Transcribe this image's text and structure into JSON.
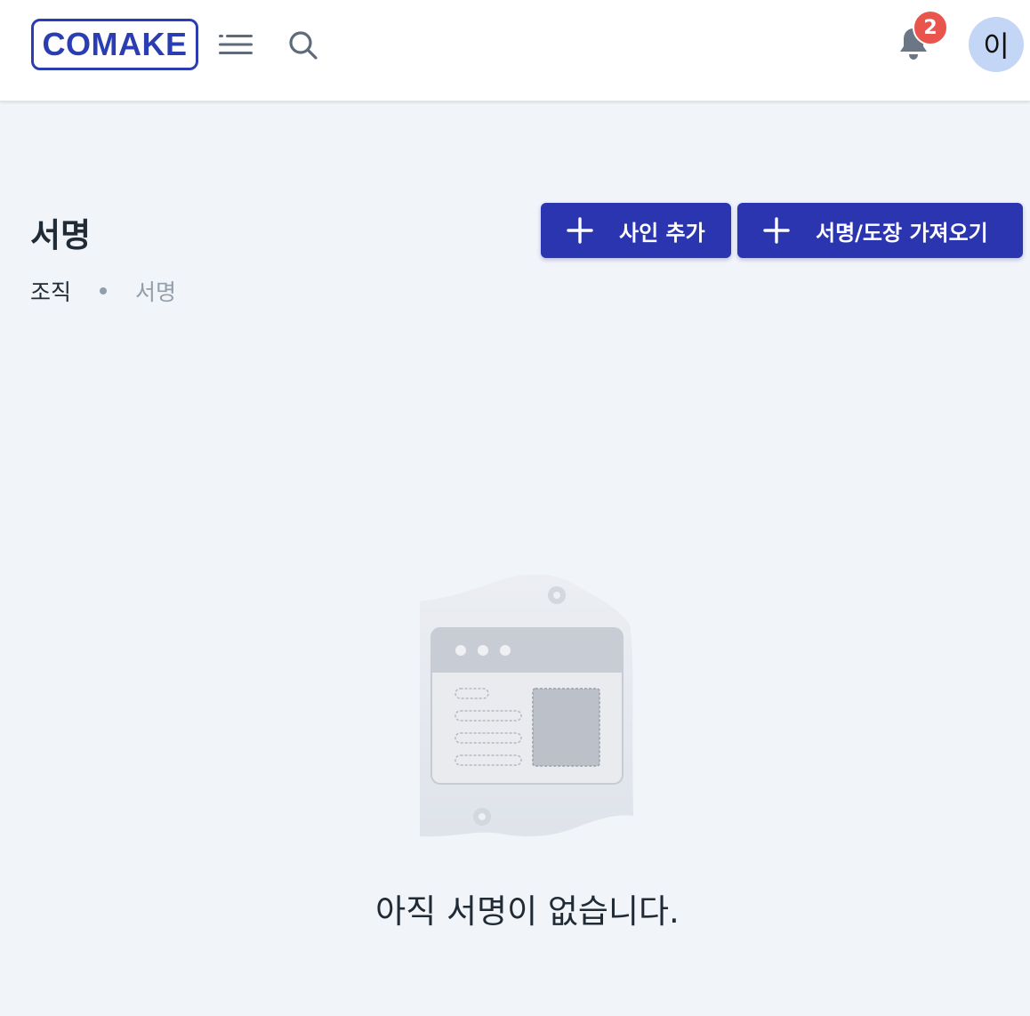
{
  "header": {
    "logo_text": "COMAKE",
    "menu_icon": "hamburger-menu-icon",
    "search_icon": "search-icon",
    "bell_icon": "bell-icon",
    "notification_count": "2",
    "avatar_initial": "이"
  },
  "page": {
    "title": "서명",
    "breadcrumb": [
      {
        "label": "조직"
      },
      {
        "label": "서명"
      }
    ]
  },
  "actions": {
    "add_sign_label": "사인 추가",
    "import_label": "서명/도장 가져오기"
  },
  "empty_state": {
    "message": "아직 서명이 없습니다.",
    "illustration_icon": "empty-document-illustration"
  },
  "colors": {
    "brand": "#2a3eb1",
    "button": "#2b35b0",
    "badge": "#e9544c",
    "avatar_bg": "#c4d6f5",
    "background": "#f1f4f9",
    "muted_text": "#919eab"
  }
}
